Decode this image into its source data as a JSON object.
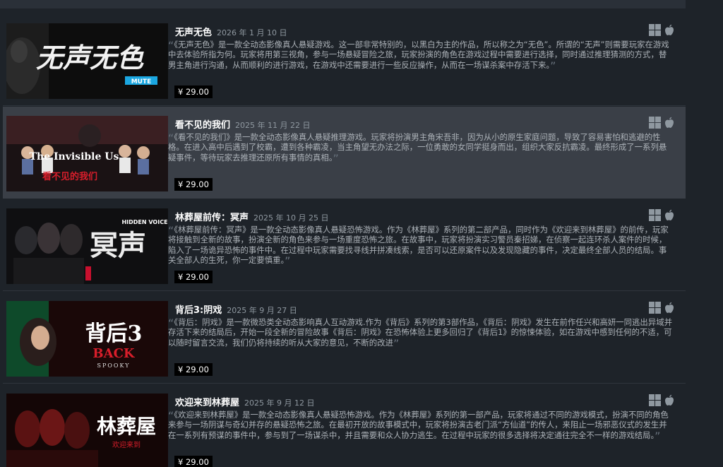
{
  "games": [
    {
      "title": "无声无色",
      "date": "2026 年 1 月 10 日",
      "description": "《无声无色》是一款全动态影像真人悬疑游戏。这一部非常特别的，以黑白为主的作品，所以称之为“无色”。所谓的“无声”则需要玩家在游戏中去体验所指为何。玩家将用第三视角，参与一场悬疑冒险之旅，玩家扮演的角色在游戏过程中需要进行选择，同时通过推理猜测的方式，替男主角进行沟通，从而顺利的进行游戏，在游戏中还需要进行一些反应操作，从而在一场谋杀案中存活下来。",
      "price": "¥ 29.00",
      "capsule_title": "无声无色",
      "capsule_sub": "MUTE",
      "platforms": [
        "windows-icon",
        "apple-icon"
      ]
    },
    {
      "title": "看不见的我们",
      "date": "2025 年 11 月 22 日",
      "description": "《看不见的我们》是一款全动态影像真人悬疑推理游戏。玩家将扮演男主角宋吾非，因为从小的原生家庭问题，导致了容易害怕和逃避的性格。在进入高中后遇到了校霸，遭到各种霸凌，当主角望无办法之际，一位勇敢的女同学挺身而出，组织大家反抗霸凌。最终形成了一系列悬疑事件，等待玩家去推理还原所有事情的真相。",
      "price": "¥ 29.00",
      "capsule_title": "The Invisible Us",
      "capsule_sub": "看不见的我们",
      "platforms": [
        "windows-icon",
        "apple-icon"
      ]
    },
    {
      "title": "林葬屋前传：冥声",
      "date": "2025 年 10 月 25 日",
      "description": "《林葬屋前传：冥声》是一款全动态影像真人悬疑恐怖游戏。作为《林葬屋》系列的第二部产品，同时作为《欢迎来到林葬屋》的前传，玩家将接触到全新的故事，扮演全新的角色来参与一场重度恐怖之旅。在故事中，玩家将扮演实习警员秦招娣，在侦察一起连环杀人案件的时候，陷入了一场诡异恐怖的事件中。在过程中玩家需要找寻线并拼凑线索，是否可以还原案件以及发现隐藏的事件，决定最终全部人员的结局。事关全部人的生死，你一定要慎重。",
      "price": "¥ 29.00",
      "capsule_title": "冥声",
      "capsule_sub": "HIDDEN VOICE",
      "platforms": [
        "windows-icon",
        "apple-icon"
      ]
    },
    {
      "title": "背后3:阴戏",
      "date": "2025 年 9 月 27 日",
      "description": "《背后：阴戏》是一款微恐类全动态影响真人互动游戏.作为《背后》系列的第3部作品，《背后：阴戏》发生在前作任兴和高妍一同逃出异域并存活下来的结局后，开始一段全新的冒险故事《背后：阴戏》在恐怖体验上更多回归了《背后1》的惊悚体验，如在游戏中感到任何的不适，可以随时留言交流，我们仍将持续的听从大家的意见，不断的改进",
      "price": "¥ 29.00",
      "capsule_title": "背后3",
      "capsule_sub": "BACK",
      "capsule_sub2": "SPOOKY",
      "platforms": [
        "windows-icon",
        "apple-icon"
      ]
    },
    {
      "title": "欢迎来到林葬屋",
      "date": "2025 年 9 月 12 日",
      "description": "《欢迎来到林葬屋》是一款全动态影像真人悬疑恐怖游戏。作为《林葬屋》系列的第一部产品，玩家将通过不同的游戏模式，扮演不同的角色来参与一场阴谋与奇幻并存的悬疑恐怖之旅。在最初开放的故事模式中，玩家将扮演古老门派“方仙道”的传人，来阻止一场邪恶仪式的发生并在一系列有预谋的事件中，参与到了一场谋杀中，并且需要和众人协力逃生。在过程中玩家的很多选择将决定通往完全不一样的游戏结局。",
      "price": "¥ 29.00",
      "capsule_title": "林葬屋",
      "capsule_sub": "欢迎来到",
      "platforms": [
        "windows-icon",
        "apple-icon"
      ]
    }
  ],
  "colors": {
    "background": "#1e2329",
    "highlight_row": "#3a3f47",
    "price_bg": "#000000",
    "accent_blue": "#1ba7e1",
    "accent_red": "#c8102e"
  }
}
